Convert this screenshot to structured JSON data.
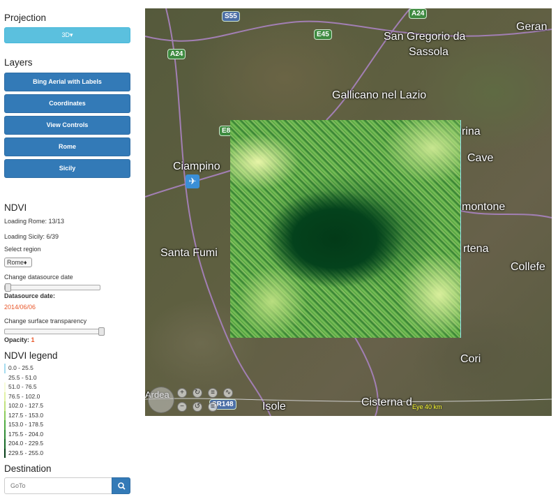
{
  "sidebar": {
    "projection": {
      "title": "Projection",
      "button_label": "3D▾"
    },
    "layers": {
      "title": "Layers",
      "items": [
        "Bing Aerial with Labels",
        "Coordinates",
        "View Controls",
        "Rome",
        "Sicily"
      ]
    },
    "ndvi": {
      "title": "NDVI",
      "loading_rome": "Loading Rome: 13/13",
      "loading_sicily": "Loading Sicily: 6/39",
      "select_region_label": "Select region",
      "region_value": "Rome♦",
      "change_date_label": "Change datasource date",
      "date_slider_value": 0,
      "datasource_date_label": "Datasource date:",
      "datasource_date": "2014/06/06",
      "transparency_label": "Change surface transparency",
      "transparency_slider_value": 1,
      "opacity_label": "Opacity:",
      "opacity_value": "1"
    },
    "legend": {
      "title": "NDVI legend",
      "entries": [
        {
          "range": "0.0  -  25.5",
          "color": "#a6dcf0"
        },
        {
          "range": "25.5  -  51.0",
          "color": "#ffffff"
        },
        {
          "range": "51.0  -  76.5",
          "color": "#f6fbd8"
        },
        {
          "range": "76.5  -  102.0",
          "color": "#e2f2a6"
        },
        {
          "range": "102.0  -  127.5",
          "color": "#c1e27d"
        },
        {
          "range": "127.5  -  153.0",
          "color": "#8ccb5a"
        },
        {
          "range": "153.0  -  178.5",
          "color": "#4fab42"
        },
        {
          "range": "175.5  -  204.0",
          "color": "#2e8a34"
        },
        {
          "range": "204.0  -  229.5",
          "color": "#176a27"
        },
        {
          "range": "229.5  -  255.0",
          "color": "#063d17"
        }
      ]
    },
    "destination": {
      "title": "Destination",
      "placeholder": "GoTo"
    }
  },
  "map": {
    "labels": [
      "San Gregorio da",
      "Sassola",
      "Geran",
      "Gallicano nel Lazio",
      "rina",
      "Cave",
      "Ciampino",
      "montone",
      "rtena",
      "Santa Fumi",
      "Collefe",
      "Cori",
      "Isole",
      "Cisterna d",
      "Ardea"
    ],
    "shields": [
      "S55",
      "A24",
      "A24",
      "E45",
      "E8",
      "SR148"
    ],
    "eye_altitude": "Eye  40 km"
  },
  "colors": {
    "primary": "#337ab7",
    "info": "#5bc0de",
    "date": "#e8572a"
  }
}
